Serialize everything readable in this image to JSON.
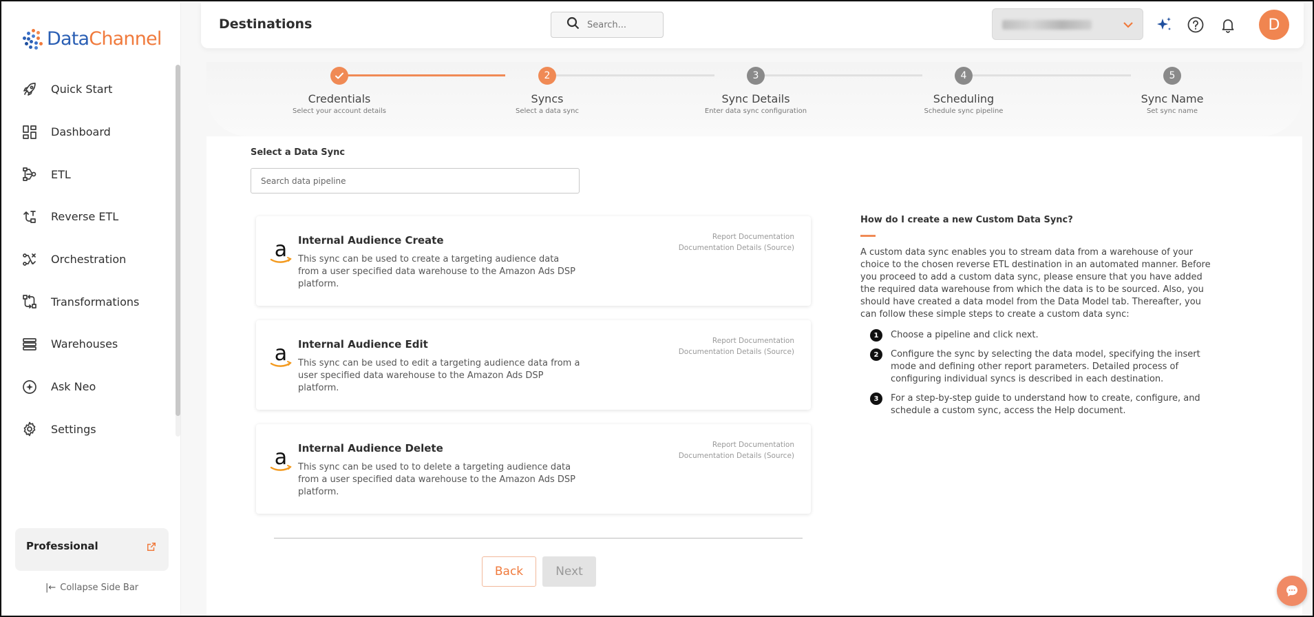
{
  "brand": {
    "name_part1": "Data",
    "name_part2": "Channel",
    "primary": "#2b5fb4",
    "accent": "#f07a3c"
  },
  "sidebar": {
    "items": [
      {
        "label": "Quick Start",
        "icon": "rocket-icon"
      },
      {
        "label": "Dashboard",
        "icon": "dashboard-icon"
      },
      {
        "label": "ETL",
        "icon": "etl-icon"
      },
      {
        "label": "Reverse ETL",
        "icon": "reverse-etl-icon"
      },
      {
        "label": "Orchestration",
        "icon": "orchestration-icon"
      },
      {
        "label": "Transformations",
        "icon": "transformations-icon"
      },
      {
        "label": "Warehouses",
        "icon": "warehouses-icon"
      },
      {
        "label": "Ask Neo",
        "icon": "ask-neo-icon"
      },
      {
        "label": "Settings",
        "icon": "gear-icon"
      }
    ],
    "plan": "Professional",
    "collapse": "Collapse Side Bar"
  },
  "header": {
    "title": "Destinations",
    "search_placeholder": "Search..."
  },
  "user": {
    "initial": "D"
  },
  "stepper": {
    "steps": [
      {
        "title": "Credentials",
        "subtitle": "Select your account details",
        "num": "1",
        "state": "done"
      },
      {
        "title": "Syncs",
        "subtitle": "Select a data sync",
        "num": "2",
        "state": "active"
      },
      {
        "title": "Sync Details",
        "subtitle": "Enter data sync configuration",
        "num": "3",
        "state": "pending"
      },
      {
        "title": "Scheduling",
        "subtitle": "Schedule sync pipeline",
        "num": "4",
        "state": "pending"
      },
      {
        "title": "Sync Name",
        "subtitle": "Set sync name",
        "num": "5",
        "state": "pending"
      }
    ]
  },
  "main": {
    "select_label": "Select a Data Sync",
    "search_placeholder": "Search data pipeline",
    "cards": [
      {
        "title": "Internal Audience Create",
        "description": "This sync can be used to create a targeting audience data from a user specified data warehouse to the Amazon Ads DSP platform.",
        "link1": "Report Documentation",
        "link2": "Documentation Details (Source)"
      },
      {
        "title": "Internal Audience Edit",
        "description": "This sync can be used to edit a targeting audience data from a user specified data warehouse to the Amazon Ads DSP platform.",
        "link1": "Report Documentation",
        "link2": "Documentation Details (Source)"
      },
      {
        "title": "Internal Audience Delete",
        "description": "This sync can be used to to delete a targeting audience data from a user specified data warehouse to the Amazon Ads DSP platform.",
        "link1": "Report Documentation",
        "link2": "Documentation Details (Source)"
      }
    ],
    "back_label": "Back",
    "next_label": "Next"
  },
  "help": {
    "title": "How do I create a new Custom Data Sync?",
    "body": "A custom data sync enables you to stream data from a warehouse of your choice to the chosen reverse ETL destination in an automated manner. Before you proceed to add a custom data sync, please ensure that you have added the required data warehouse from which the data is to be sourced. Also, you should have created a data model from the Data Model tab. Thereafter, you can follow these simple steps to create a custom data sync:",
    "steps": [
      {
        "num": "1",
        "text": "Choose a pipeline and click next."
      },
      {
        "num": "2",
        "text": "Configure the sync by selecting the data model, specifying the insert mode and defining other report parameters. Detailed process of configuring individual syncs is described in each destination."
      },
      {
        "num": "3",
        "text": "For a step-by-step guide to understand how to create, configure, and schedule a custom sync, access the Help document."
      }
    ]
  }
}
